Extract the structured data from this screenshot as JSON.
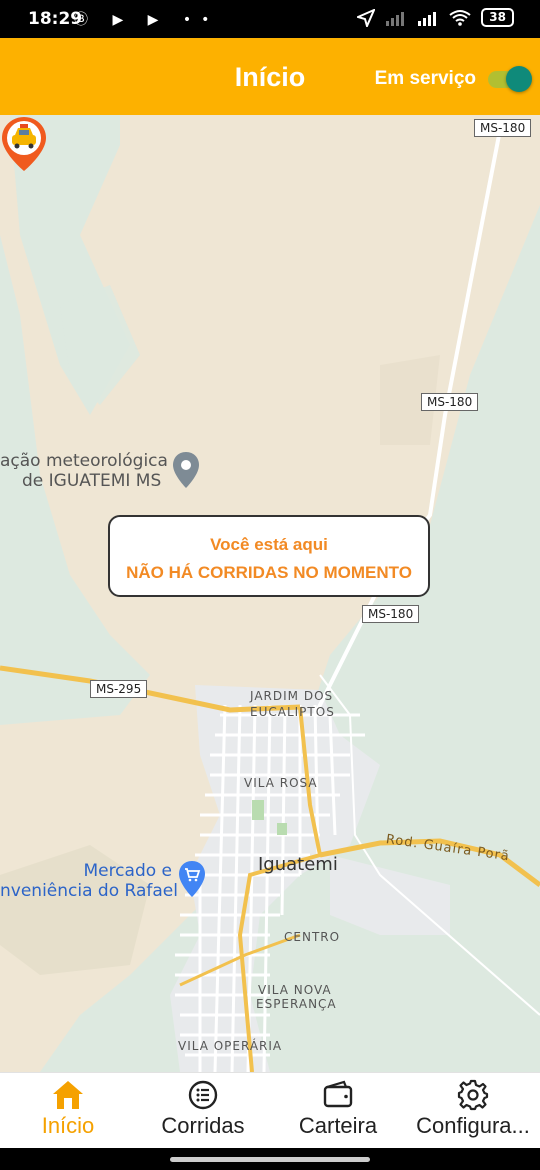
{
  "status_bar": {
    "time": "18:29",
    "left_icons": "Ⓑ ▶ ▶ ••",
    "battery": "38"
  },
  "app_bar": {
    "title": "Início",
    "service_label": "Em serviço",
    "service_on": true
  },
  "map": {
    "info_line1": "Você está aqui",
    "info_line2": "NÃO HÁ CORRIDAS NO MOMENTO",
    "road_shields": [
      "MS-180",
      "MS-180",
      "MS-180",
      "MS-295"
    ],
    "road_name": "Rod. Guaíra Porã",
    "neighborhoods": [
      "JARDIM DOS",
      "EUCALIPTOS",
      "VILA ROSA",
      "CENTRO",
      "VILA NOVA",
      "ESPERANÇA",
      "VILA OPERÁRIA"
    ],
    "city": "Iguatemi",
    "poi1_line1": "ação meteorológica",
    "poi1_line2": "de IGUATEMI MS",
    "poi2_line1": "Mercado e",
    "poi2_line2": "nveniência do Rafael",
    "colors": {
      "land": "#efe6d4",
      "green": "#dde9e0",
      "road": "#f7c94b",
      "pin": "#f05a1e"
    }
  },
  "bottom_nav": {
    "items": [
      {
        "label": "Início",
        "icon": "home-icon",
        "active": true
      },
      {
        "label": "Corridas",
        "icon": "list-icon",
        "active": false
      },
      {
        "label": "Carteira",
        "icon": "wallet-icon",
        "active": false
      },
      {
        "label": "Configura...",
        "icon": "gear-icon",
        "active": false
      }
    ]
  }
}
